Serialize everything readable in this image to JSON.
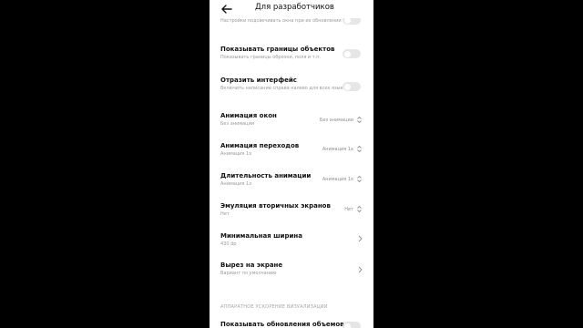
{
  "header": {
    "title": "Для разработчиков",
    "back_icon": "arrow-left-icon"
  },
  "partial_top_text": "Настройки подсвечивать окна при их обновлении",
  "rows": [
    {
      "name": "Показывать границы объектов",
      "sub": "Показывать границы обрезки, поля и т.п.",
      "control": "toggle",
      "on": false
    },
    {
      "name": "Отразить интерфейс",
      "sub": "Включить написание справа налево для всех языков",
      "control": "toggle",
      "on": false
    },
    {
      "name": "Анимация окон",
      "sub": "Без анимации",
      "control": "select",
      "value": "Без анимации"
    },
    {
      "name": "Анимация переходов",
      "sub": "Анимация 1x",
      "control": "select",
      "value": "Анимация 1x"
    },
    {
      "name": "Длительность анимации",
      "sub": "Анимация 1x",
      "control": "select",
      "value": "Анимация 1x"
    },
    {
      "name": "Эмуляция вторичных экранов",
      "sub": "Нет",
      "control": "select",
      "value": "Нет"
    },
    {
      "name": "Минимальная ширина",
      "sub": "430 dp",
      "control": "chevron"
    },
    {
      "name": "Вырез на экране",
      "sub": "Вариант по умолчанию",
      "control": "chevron"
    }
  ],
  "section_header": "АППАРАТНОЕ УСКОРЕНИЕ ВИЗУАЛИЗАЦИИ",
  "partial_bottom_text": "Показывать обновления объемов",
  "colors": {
    "background": "#000000",
    "screen": "#ffffff",
    "toggle_off": "#e6e6e6",
    "text": "#111111",
    "subtext": "#9a9a9a"
  }
}
